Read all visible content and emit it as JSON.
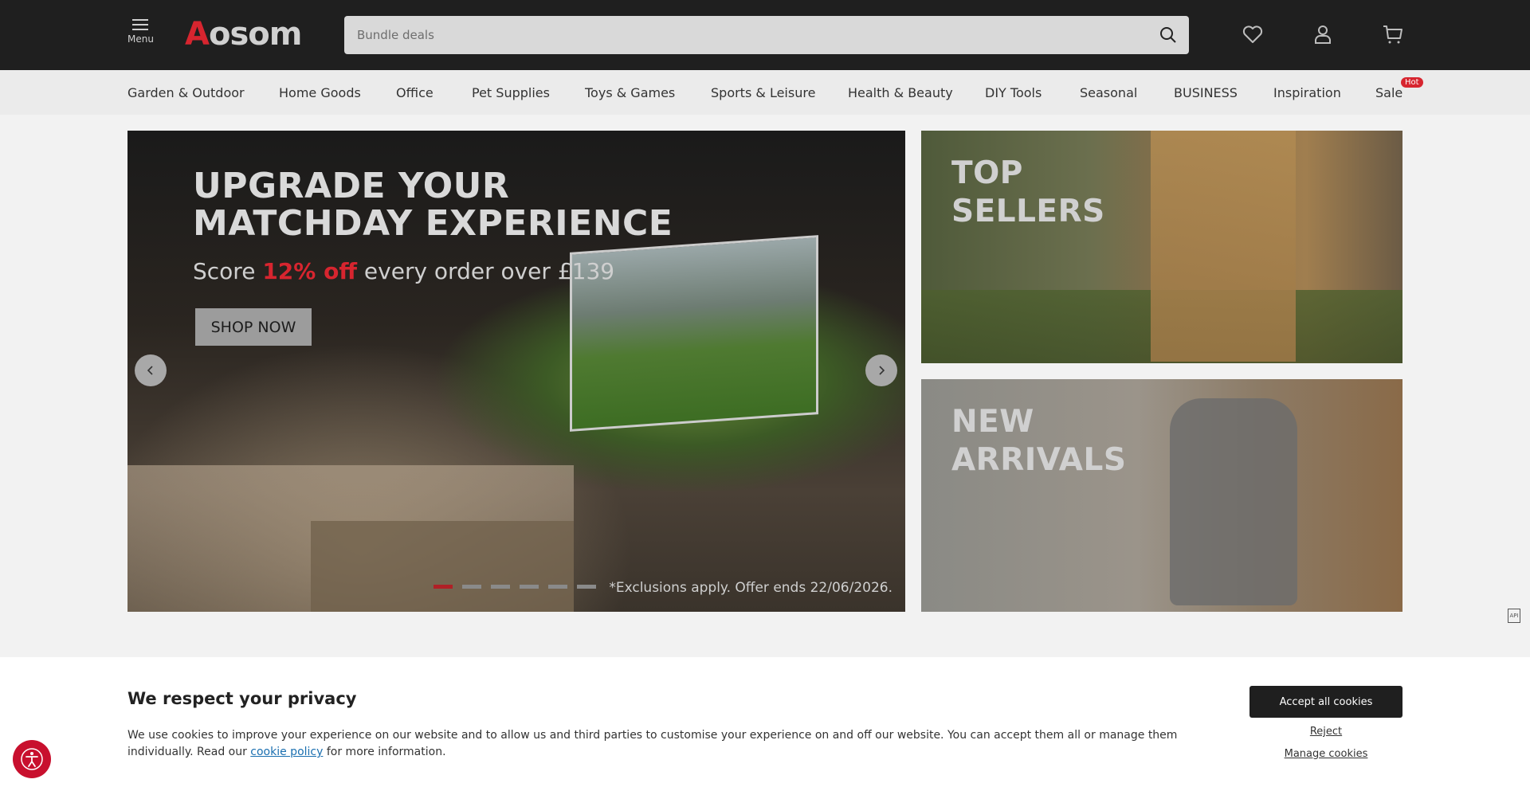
{
  "header": {
    "menu_label": "Menu",
    "logo_first": "A",
    "logo_rest": "osom",
    "search_placeholder": "Bundle deals",
    "icons": [
      "search-icon",
      "heart-icon",
      "user-icon",
      "cart-icon"
    ]
  },
  "nav": {
    "items": [
      "Garden & Outdoor",
      "Home Goods",
      "Office",
      "Pet Supplies",
      "Toys & Games",
      "Sports & Leisure",
      "Health & Beauty",
      "DIY Tools",
      "Seasonal",
      "BUSINESS",
      "Inspiration",
      "Sale"
    ],
    "hot_badge": "Hot"
  },
  "hero": {
    "title_line1": "UPGRADE YOUR",
    "title_line2": "MATCHDAY EXPERIENCE",
    "sub_before": "Score ",
    "sub_highlight": "12% off",
    "sub_after": " every order over £139",
    "button": "SHOP NOW",
    "exclusions": "*Exclusions apply. Offer ends 22/06/2026.",
    "slide_count": 6,
    "active_slide": 1
  },
  "banners": {
    "top_line1": "TOP",
    "top_line2": "SELLERS",
    "bottom_line1": "NEW",
    "bottom_line2": "ARRIVALS"
  },
  "side_icon_label": "API",
  "cookie": {
    "title": "We respect your privacy",
    "text_before": "We use cookies to improve your experience on our website and to allow us and third parties to customise your experience on and off our website. You can accept them all or manage them individually. Read our ",
    "link": "cookie policy",
    "text_after": " for more information.",
    "accept": "Accept all cookies",
    "reject": "Reject",
    "manage": "Manage cookies"
  },
  "colors": {
    "brand_red": "#d7252f",
    "header_bg": "#1f1f1f"
  }
}
